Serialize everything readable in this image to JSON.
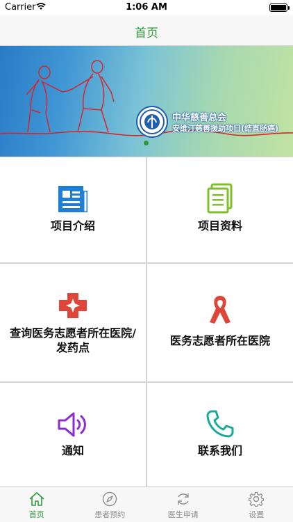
{
  "status_bar": {
    "carrier": "Carrier",
    "time": "1:06 AM"
  },
  "nav": {
    "title": "首页"
  },
  "banner": {
    "org_name": "中华慈善总会",
    "project_name": "安维汀慈善援助项目(结直肠癌)"
  },
  "grid": {
    "items": [
      {
        "label": "项目介绍",
        "icon": "newspaper-icon"
      },
      {
        "label": "项目资料",
        "icon": "document-icon"
      },
      {
        "label_line1": "查询医务志愿者所在医院/",
        "label_line2": "发药点",
        "icon": "medical-cross-icon"
      },
      {
        "label": "医务志愿者所在医院",
        "icon": "awareness-ribbon-icon"
      },
      {
        "label": "通知",
        "icon": "speaker-icon"
      },
      {
        "label": "联系我们",
        "icon": "phone-icon"
      }
    ]
  },
  "tab_bar": {
    "tabs": [
      {
        "label": "首页",
        "icon": "home-icon",
        "active": true
      },
      {
        "label": "患者预约",
        "icon": "compass-icon"
      },
      {
        "label": "医生申请",
        "icon": "refresh-icon"
      },
      {
        "label": "设置",
        "icon": "gear-icon"
      }
    ]
  },
  "colors": {
    "accent": "#2e9a3c",
    "blue_icon": "#1f7fd6",
    "green_icon": "#7fbf2a",
    "red_icon": "#e0453a",
    "purple_icon": "#8a2ccf",
    "teal_icon": "#1aa89a"
  }
}
